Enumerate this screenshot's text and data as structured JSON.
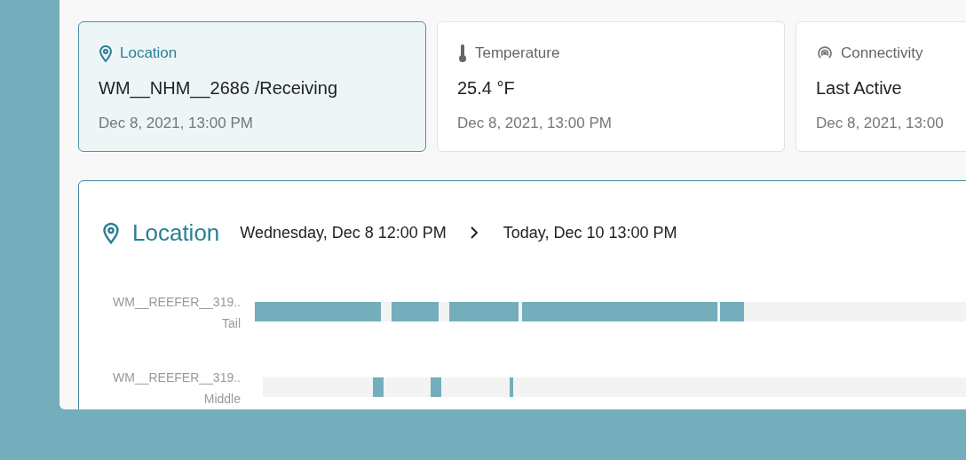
{
  "cards": [
    {
      "kind": "location",
      "label": "Location",
      "value": "WM__NHM__2686 /Receiving",
      "time": "Dec 8, 2021, 13:00 PM",
      "selected": true
    },
    {
      "kind": "temperature",
      "label": "Temperature",
      "value": "25.4 °F",
      "time": "Dec 8, 2021, 13:00 PM",
      "selected": false
    },
    {
      "kind": "connectivity",
      "label": "Connectivity",
      "value": "Last Active",
      "time": "Dec 8, 2021, 13:00",
      "selected": false
    }
  ],
  "timeline": {
    "title": "Location",
    "start": "Wednesday, Dec 8 12:00 PM",
    "end": "Today, Dec 10 13:00 PM",
    "rows": [
      {
        "name": "WM__REEFER__319..",
        "position": "Tail"
      },
      {
        "name": "WM__REEFER__319..",
        "position": "Middle"
      }
    ]
  }
}
